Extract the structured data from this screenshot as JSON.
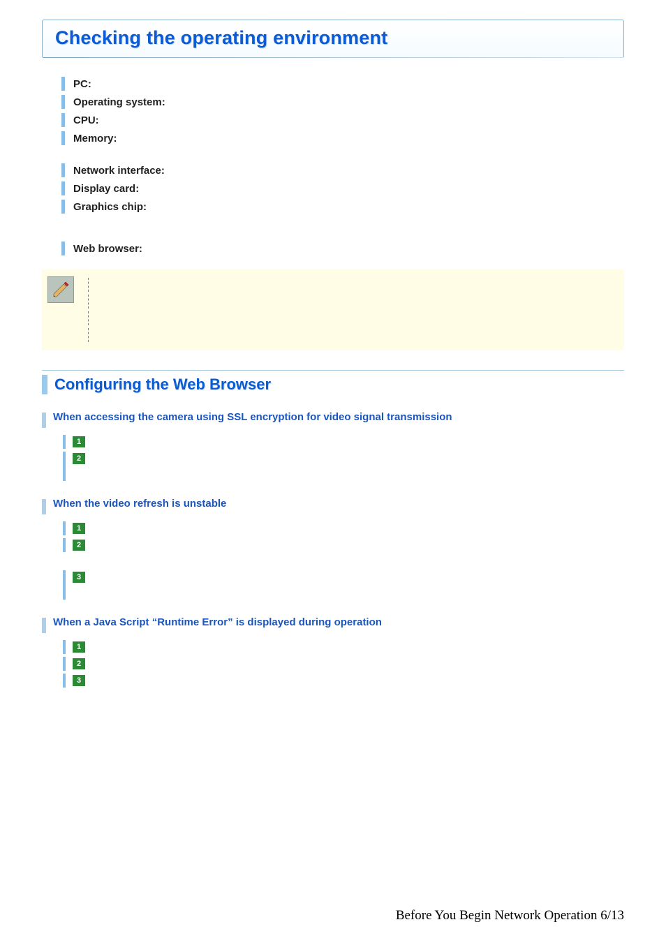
{
  "header": {
    "title": "Checking the operating environment"
  },
  "requirements": {
    "group1": [
      {
        "label": "PC:"
      },
      {
        "label": "Operating system:"
      },
      {
        "label": "CPU:"
      },
      {
        "label": "Memory:"
      }
    ],
    "group2": [
      {
        "label": "Network interface:"
      },
      {
        "label": "Display card:"
      },
      {
        "label": "Graphics chip:"
      }
    ],
    "group3": [
      {
        "label": "Web browser:"
      }
    ]
  },
  "section2": {
    "title": "Configuring the Web Browser",
    "subsections": [
      {
        "title": "When accessing the camera using SSL encryption for video signal transmission",
        "steps": [
          "1",
          "2"
        ],
        "trailing_tall": true
      },
      {
        "title": "When the video refresh is unstable",
        "steps": [
          "1",
          "2"
        ],
        "extra_step": "3",
        "extra_tall": true
      },
      {
        "title": "When a Java Script “Runtime Error” is displayed during operation",
        "steps": [
          "1",
          "2",
          "3"
        ]
      }
    ]
  },
  "footer": {
    "text": "Before You Begin Network Operation 6/13"
  }
}
